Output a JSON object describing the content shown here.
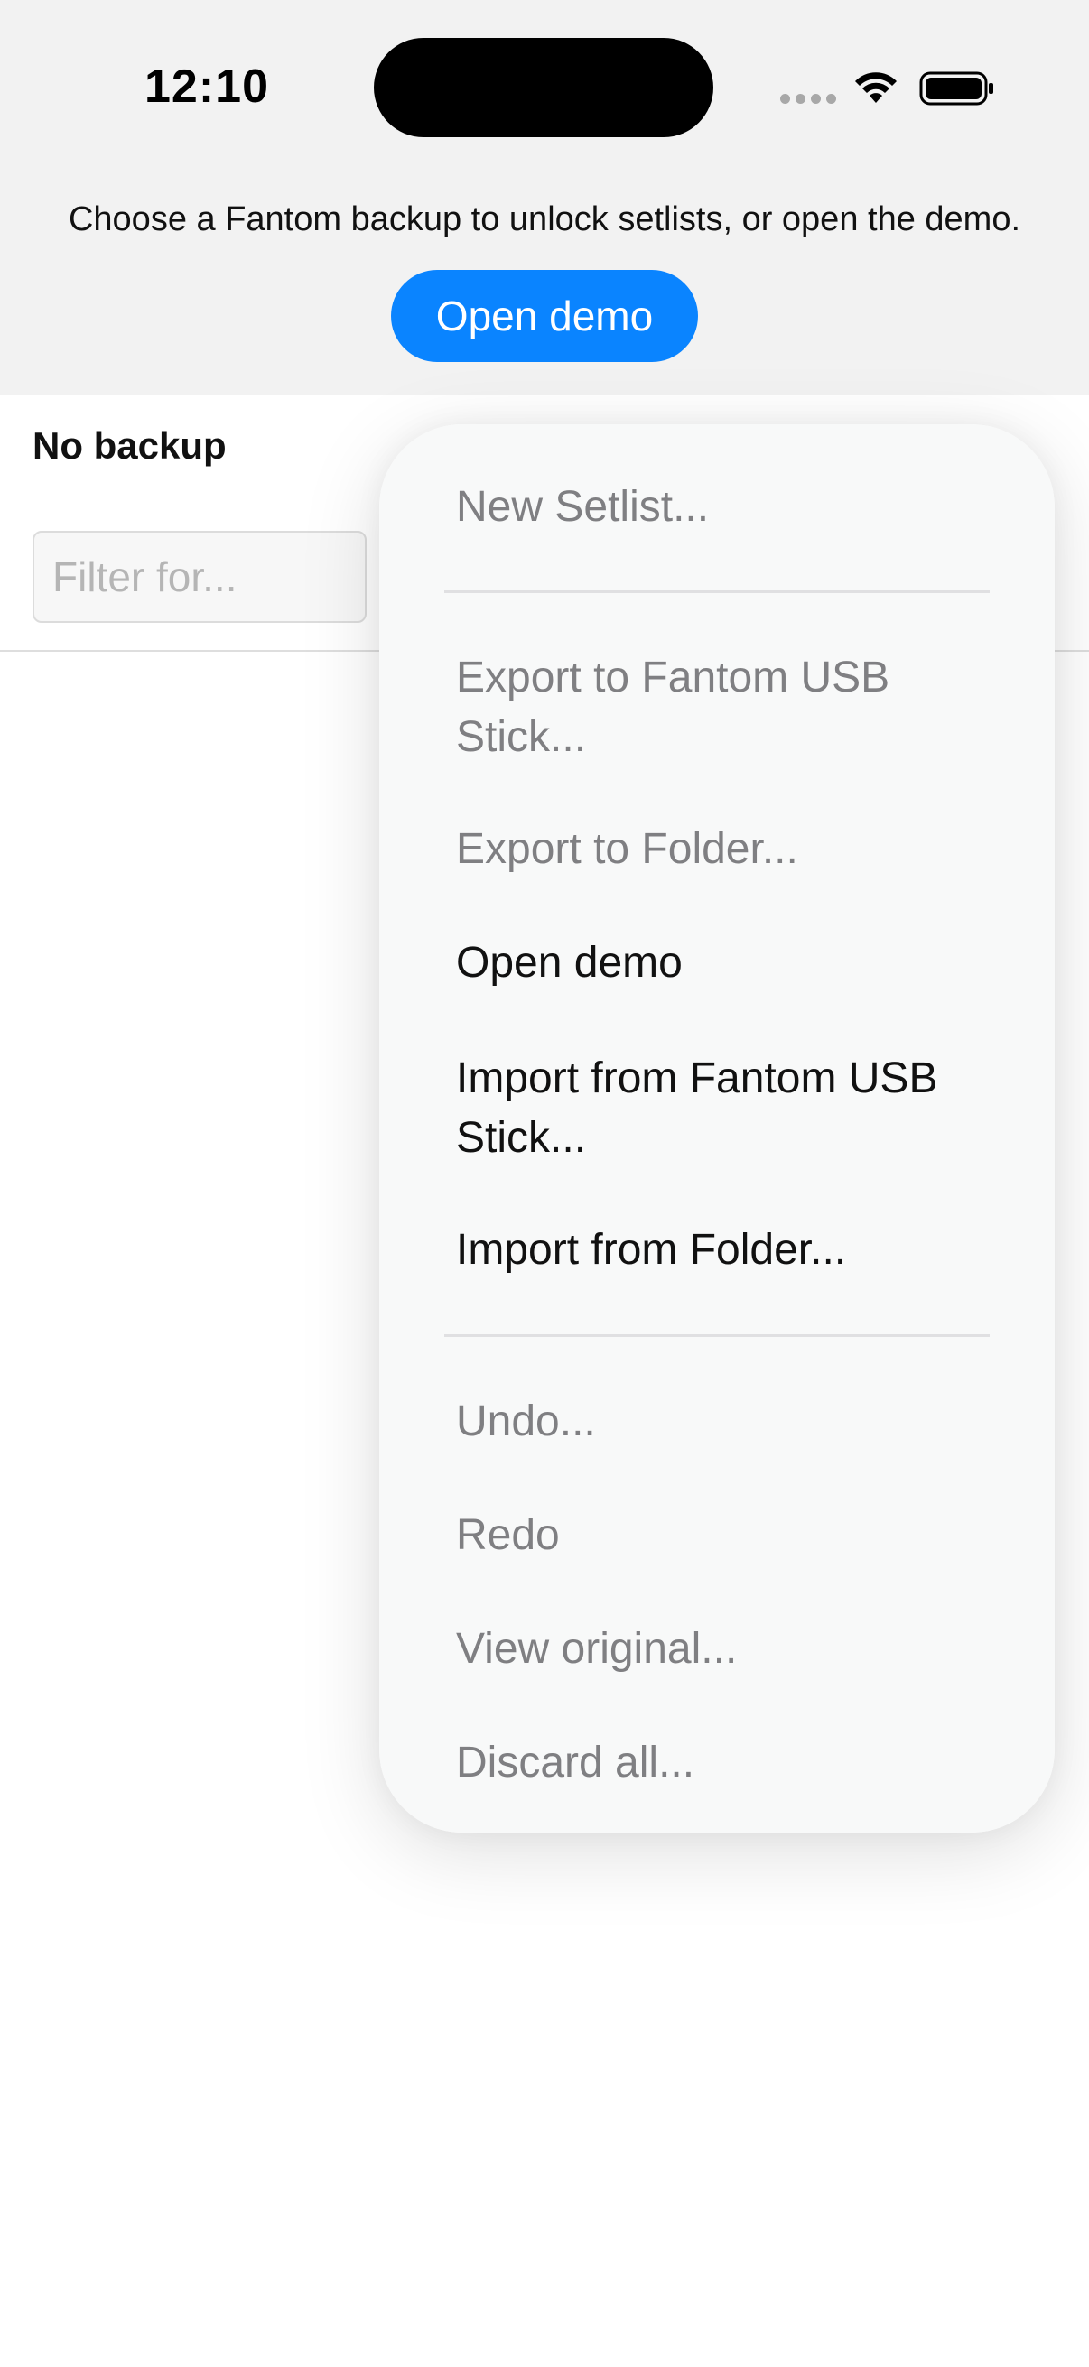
{
  "status_bar": {
    "time": "12:10"
  },
  "banner": {
    "message": "Choose a Fantom backup to unlock setlists, or open the demo.",
    "open_demo_label": "Open demo"
  },
  "backup": {
    "title": "No backup",
    "filter_placeholder": "Filter for..."
  },
  "menu": {
    "new_setlist": "New Setlist...",
    "export_usb": "Export to Fantom USB Stick...",
    "export_folder": "Export to Folder...",
    "open_demo": "Open demo",
    "import_usb": "Import from Fantom USB Stick...",
    "import_folder": "Import from Folder...",
    "undo": "Undo...",
    "redo": "Redo",
    "view_original": "View original...",
    "discard_all": "Discard all..."
  },
  "colors": {
    "accent": "#0a84ff",
    "disabled_text": "#7f7f82",
    "top_background": "#f2f2f2"
  }
}
